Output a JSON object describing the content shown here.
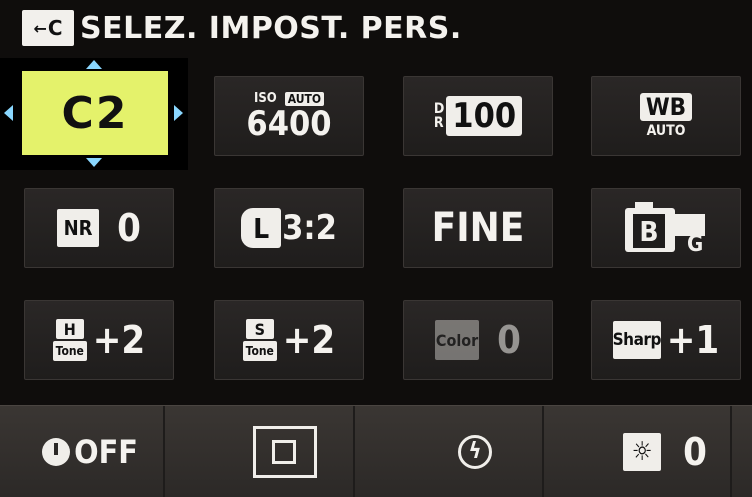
{
  "header": {
    "back_icon_label": "C",
    "title": "SELEZ. IMPOST. PERS."
  },
  "custom_setting": {
    "value": "C2"
  },
  "iso": {
    "label": "ISO",
    "mode": "AUTO",
    "value": "6400"
  },
  "dynamic_range": {
    "label_d": "D",
    "label_r": "R",
    "value": "100"
  },
  "white_balance": {
    "label": "WB",
    "mode": "AUTO"
  },
  "noise_reduction": {
    "label": "NR",
    "value": "0"
  },
  "image_size": {
    "size": "L",
    "ratio": "3:2"
  },
  "image_quality": {
    "value": "FINE"
  },
  "film_simulation": {
    "main": "B",
    "sub": "G"
  },
  "highlight_tone": {
    "letter": "H",
    "word": "Tone",
    "value": "+2"
  },
  "shadow_tone": {
    "letter": "S",
    "word": "Tone",
    "value": "+2"
  },
  "color": {
    "label": "Color",
    "value": "0"
  },
  "sharpness": {
    "label": "Sharp",
    "value": "+1"
  },
  "bottom": {
    "self_timer": "OFF",
    "brightness_value": "0"
  }
}
